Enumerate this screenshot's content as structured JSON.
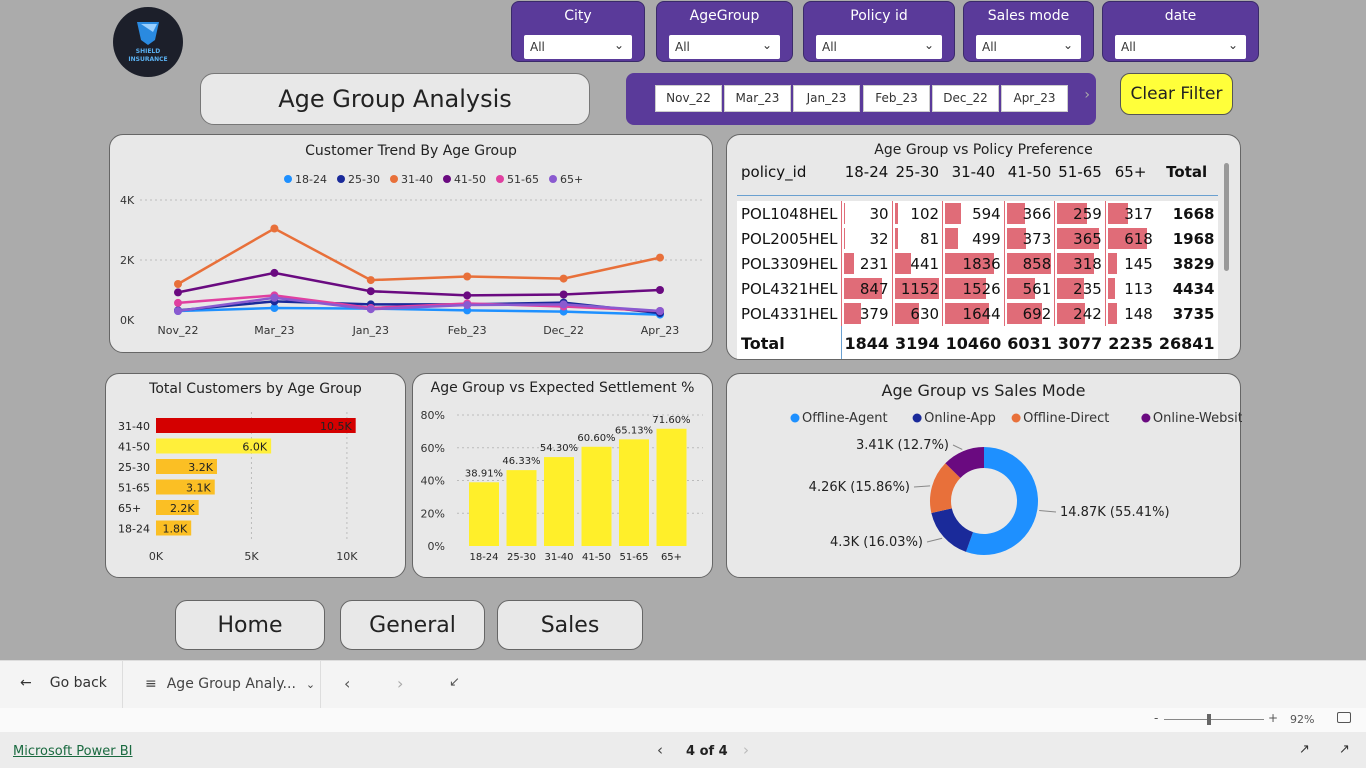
{
  "logo": {
    "line1": "SHIELD",
    "line2": "INSURANCE"
  },
  "slicers": [
    {
      "label": "City",
      "value": "All"
    },
    {
      "label": "AgeGroup",
      "value": "All"
    },
    {
      "label": "Policy id",
      "value": "All"
    },
    {
      "label": "Sales mode",
      "value": "All"
    },
    {
      "label": "date",
      "value": "All"
    }
  ],
  "page_title": "Age Group Analysis",
  "date_buttons": [
    "Nov_22",
    "Mar_23",
    "Jan_23",
    "Feb_23",
    "Dec_22",
    "Apr_23"
  ],
  "clear_filter": "Clear Filter",
  "nav_buttons": [
    "Home",
    "General",
    "Sales"
  ],
  "bottom_bar": {
    "go_back": "Go back",
    "page_name": "Age Group Analy...",
    "zoom": "92%"
  },
  "footer": {
    "brand": "Microsoft Power BI",
    "page_indicator": "4 of 4"
  },
  "colors": {
    "slicer_bg": "#5a3a9a",
    "clear_filter_bg": "#ffff3a",
    "panel_bg": "#e8e8e8",
    "age_18_24": "#1e90ff",
    "age_25_30": "#1a2a9a",
    "age_31_40": "#e8703a",
    "age_41_50": "#6a0a80",
    "age_51_65": "#e040a0",
    "age_65_plus": "#8a5ad0"
  },
  "chart_data": [
    {
      "type": "line",
      "title": "Customer Trend By Age Group",
      "x": [
        "Nov_22",
        "Mar_23",
        "Jan_23",
        "Feb_23",
        "Dec_22",
        "Apr_23"
      ],
      "yticks": [
        "0K",
        "2K",
        "4K"
      ],
      "ylim": [
        0,
        4000
      ],
      "grid": true,
      "legend": "top",
      "series": [
        {
          "name": "18-24",
          "values": [
            300,
            400,
            380,
            320,
            280,
            180
          ]
        },
        {
          "name": "25-30",
          "values": [
            320,
            620,
            520,
            520,
            580,
            230
          ]
        },
        {
          "name": "31-40",
          "values": [
            1200,
            3050,
            1330,
            1450,
            1380,
            2080
          ]
        },
        {
          "name": "41-50",
          "values": [
            920,
            1570,
            960,
            820,
            850,
            1000
          ]
        },
        {
          "name": "51-65",
          "values": [
            570,
            820,
            400,
            550,
            450,
            300
          ]
        },
        {
          "name": "65+",
          "values": [
            300,
            740,
            360,
            500,
            520,
            300
          ]
        }
      ]
    },
    {
      "type": "table",
      "title": "Age Group vs Policy Preference",
      "columns": [
        "policy_id",
        "18-24",
        "25-30",
        "31-40",
        "41-50",
        "51-65",
        "65+",
        "Total"
      ],
      "rows": [
        [
          "POL1048HEL",
          "30",
          "102",
          "594",
          "366",
          "259",
          "317",
          "1668"
        ],
        [
          "POL2005HEL",
          "32",
          "81",
          "499",
          "373",
          "365",
          "618",
          "1968"
        ],
        [
          "POL3309HEL",
          "231",
          "441",
          "1836",
          "858",
          "318",
          "145",
          "3829"
        ],
        [
          "POL4321HEL",
          "847",
          "1152",
          "1526",
          "561",
          "235",
          "113",
          "4434"
        ],
        [
          "POL4331HEL",
          "379",
          "630",
          "1644",
          "692",
          "242",
          "148",
          "3735"
        ]
      ],
      "total_row": [
        "Total",
        "1844",
        "3194",
        "10460",
        "6031",
        "3077",
        "2235",
        "26841"
      ]
    },
    {
      "type": "bar",
      "orientation": "horizontal",
      "title": "Total Customers by Age Group",
      "categories": [
        "31-40",
        "41-50",
        "25-30",
        "51-65",
        "65+",
        "18-24"
      ],
      "values": [
        10460,
        6031,
        3194,
        3077,
        2235,
        1844
      ],
      "labels": [
        "10.5K",
        "6.0K",
        "3.2K",
        "3.1K",
        "2.2K",
        "1.8K"
      ],
      "bar_colors": [
        "#d40000",
        "#ffef3a",
        "#fbbf24",
        "#fbbf24",
        "#fbbf24",
        "#fbbf24"
      ],
      "xticks": [
        "0K",
        "5K",
        "10K"
      ],
      "xlim": [
        0,
        11000
      ]
    },
    {
      "type": "bar",
      "title": "Age Group vs Expected Settlement %",
      "categories": [
        "18-24",
        "25-30",
        "31-40",
        "41-50",
        "51-65",
        "65+"
      ],
      "values": [
        38.91,
        46.33,
        54.3,
        60.6,
        65.13,
        71.6
      ],
      "labels": [
        "38.91%",
        "46.33%",
        "54.30%",
        "60.60%",
        "65.13%",
        "71.60%"
      ],
      "yticks": [
        "0%",
        "20%",
        "40%",
        "60%",
        "80%"
      ],
      "ylim": [
        0,
        80
      ]
    },
    {
      "type": "pie",
      "title": "Age Group vs Sales Mode",
      "legend": "top",
      "slices": [
        {
          "name": "Offline-Agent",
          "value": 55.41,
          "label": "14.87K (55.41%)",
          "color": "#1e90ff"
        },
        {
          "name": "Online-App",
          "value": 16.03,
          "label": "4.3K (16.03%)",
          "color": "#1a2a9a"
        },
        {
          "name": "Offline-Direct",
          "value": 15.86,
          "label": "4.26K (15.86%)",
          "color": "#e8703a"
        },
        {
          "name": "Online-Website",
          "value": 12.7,
          "label": "3.41K (12.7%)",
          "color": "#6a0a80"
        }
      ]
    }
  ]
}
